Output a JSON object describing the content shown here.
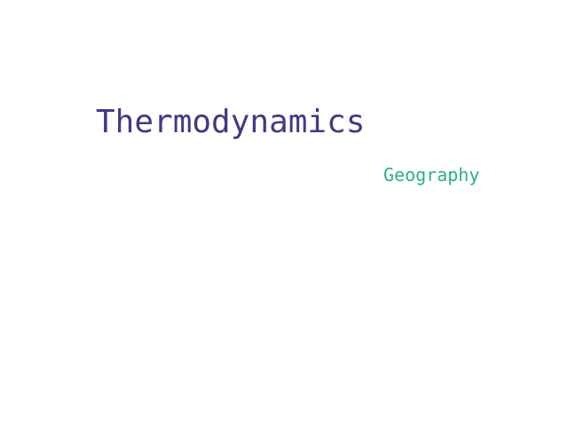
{
  "words": [
    {
      "text": "Thermodynamics",
      "color": "#443983"
    },
    {
      "text": "Geography",
      "color": "#2db27d"
    }
  ]
}
